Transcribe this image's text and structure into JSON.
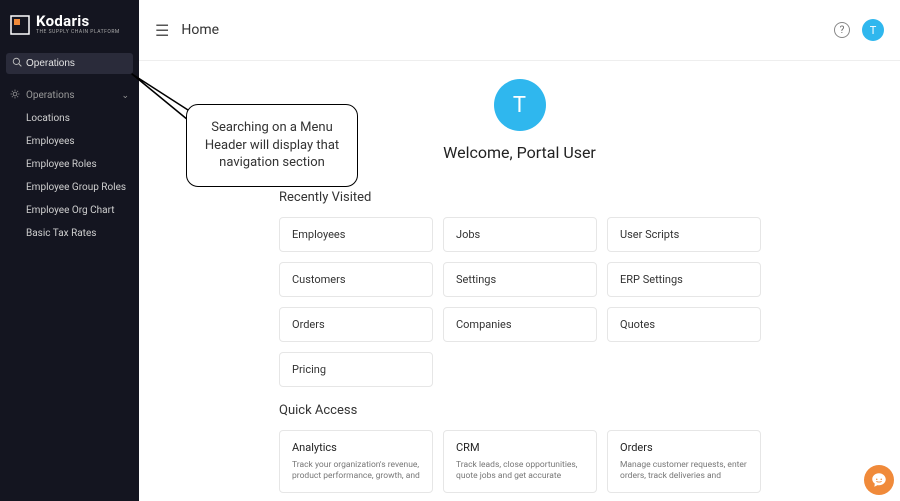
{
  "brand": {
    "name": "Kodaris",
    "tagline": "THE SUPPLY CHAIN PLATFORM"
  },
  "sidebar": {
    "search_value": "Operations",
    "section_label": "Operations",
    "items": [
      "Locations",
      "Employees",
      "Employee Roles",
      "Employee Group Roles",
      "Employee Org Chart",
      "Basic Tax Rates"
    ]
  },
  "topbar": {
    "title": "Home",
    "avatar_initial": "T"
  },
  "welcome": {
    "avatar_initial": "T",
    "text": "Welcome, Portal User"
  },
  "recent": {
    "title": "Recently Visited",
    "items": [
      "Employees",
      "Jobs",
      "User Scripts",
      "Customers",
      "Settings",
      "ERP Settings",
      "Orders",
      "Companies",
      "Quotes",
      "Pricing"
    ]
  },
  "quick": {
    "title": "Quick Access",
    "cards": [
      {
        "title": "Analytics",
        "desc": "Track your organization's revenue, product performance, growth, and"
      },
      {
        "title": "CRM",
        "desc": "Track leads, close opportunities, quote jobs and get accurate"
      },
      {
        "title": "Orders",
        "desc": "Manage customer requests, enter orders, track deliveries and"
      }
    ]
  },
  "callout": {
    "text": "Searching on a Menu Header will display that navigation section"
  }
}
